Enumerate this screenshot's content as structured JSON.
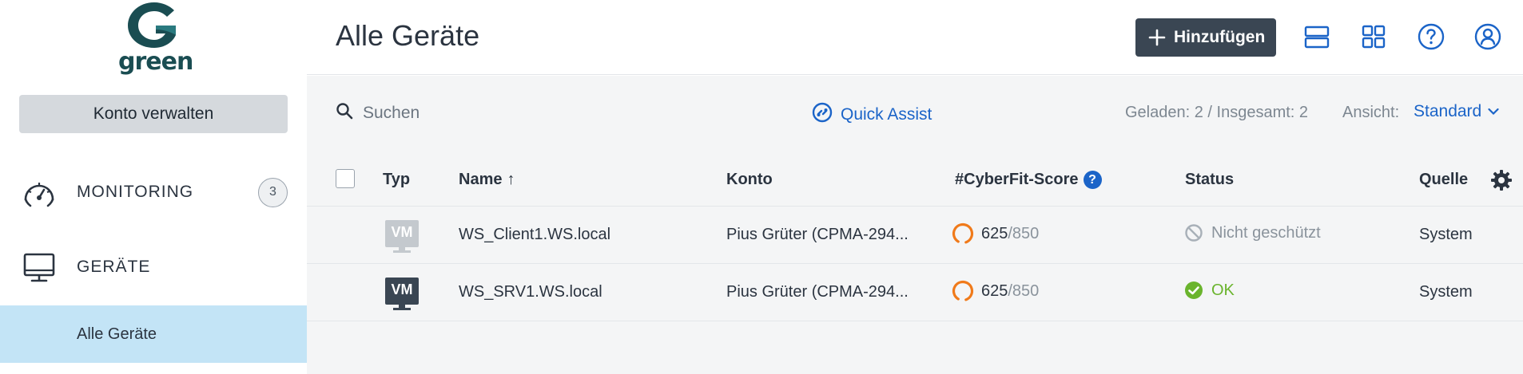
{
  "brand": {
    "logo_text": "green"
  },
  "sidebar": {
    "manage_account_label": "Konto verwalten",
    "items": [
      {
        "label": "MONITORING",
        "badge": "3",
        "icon": "speedometer-icon"
      },
      {
        "label": "GERÄTE",
        "icon": "monitor-icon"
      }
    ],
    "sub_items": [
      {
        "label": "Alle Geräte",
        "active": true
      }
    ]
  },
  "header": {
    "title": "Alle Geräte",
    "add_button_label": "Hinzufügen",
    "icons": [
      "list-view-icon",
      "grid-view-icon",
      "help-icon",
      "user-account-icon"
    ]
  },
  "toolbar": {
    "search_placeholder": "Suchen",
    "quick_assist_label": "Quick Assist",
    "loaded_text": "Geladen: 2 / Insgesamt: 2",
    "view_label": "Ansicht:",
    "view_value": "Standard"
  },
  "table": {
    "columns": {
      "type": "Typ",
      "name": "Name",
      "name_sort": "↑",
      "account": "Konto",
      "score": "#CyberFit-Score",
      "status": "Status",
      "source": "Quelle"
    },
    "rows": [
      {
        "type_label": "VM",
        "type_state": "inactive",
        "name": "WS_Client1.WS.local",
        "account": "Pius Grüter (CPMA-294...",
        "score": "625",
        "score_max": "/850",
        "status": "Nicht geschützt",
        "status_kind": "unprotected",
        "source": "System"
      },
      {
        "type_label": "VM",
        "type_state": "active",
        "name": "WS_SRV1.WS.local",
        "account": "Pius Grüter (CPMA-294...",
        "score": "625",
        "score_max": "/850",
        "status": "OK",
        "status_kind": "ok",
        "source": "System"
      }
    ]
  },
  "colors": {
    "accent": "#1b64c8",
    "dark_button": "#3a4653",
    "active_nav": "#c3e4f6",
    "score_ring": "#f07a1a",
    "status_ok": "#6ab42d",
    "logo": "#1a4d52"
  }
}
